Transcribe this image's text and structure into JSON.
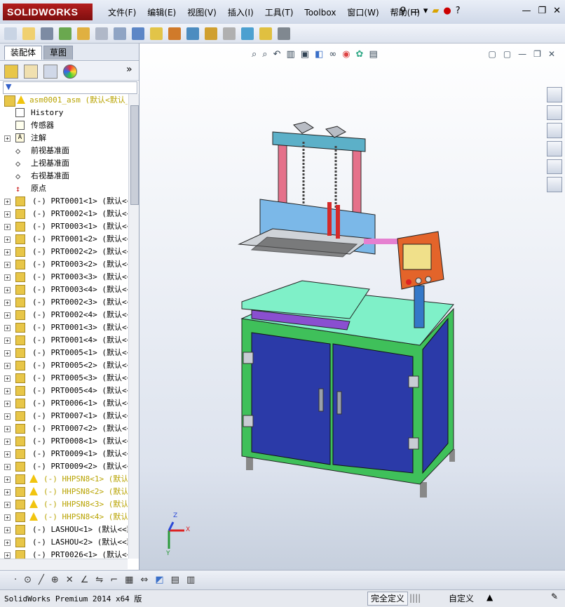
{
  "app": {
    "logo": "SOLIDWORKS"
  },
  "menu": [
    "文件(F)",
    "编辑(E)",
    "视图(V)",
    "插入(I)",
    "工具(T)",
    "Toolbox",
    "窗口(W)",
    "帮助(H)"
  ],
  "panel": {
    "tabs": [
      {
        "label": "装配体",
        "active": true
      },
      {
        "label": "草图",
        "active": false
      }
    ],
    "root": "asm0001_asm  (默认<默认_",
    "fixed_items": [
      "History",
      "传感器",
      "注解",
      "前视基准面",
      "上视基准面",
      "右视基准面",
      "原点"
    ],
    "components": [
      "(-) PRT0001<1> (默认<<",
      "(-) PRT0002<1> (默认<<",
      "(-) PRT0003<1> (默认<<",
      "(-) PRT0001<2> (默认<<",
      "(-) PRT0002<2> (默认<<",
      "(-) PRT0003<2> (默认<<",
      "(-) PRT0003<3> (默认<<",
      "(-) PRT0003<4> (默认<<",
      "(-) PRT0002<3> (默认<<",
      "(-) PRT0002<4> (默认<<",
      "(-) PRT0001<3> (默认<<",
      "(-) PRT0001<4> (默认<<",
      "(-) PRT0005<1> (默认<<",
      "(-) PRT0005<2> (默认<<",
      "(-) PRT0005<3> (默认<<",
      "(-) PRT0005<4> (默认<<",
      "(-) PRT0006<1> (默认<<",
      "(-) PRT0007<1> (默认<<",
      "(-) PRT0007<2> (默认<<",
      "(-) PRT0008<1> (默认<<",
      "(-) PRT0009<1> (默认<<",
      "(-) PRT0009<2> (默认<<"
    ],
    "warn_components": [
      "(-) HHPSN8<1> (默认<",
      "(-) HHPSN8<2> (默认<",
      "(-) HHPSN8<3> (默认<",
      "(-) HHPSN8<4> (默认<"
    ],
    "tail_components": [
      "(-) LASHOU<1> (默认<<默",
      "(-) LASHOU<2> (默认<<默",
      "(-) PRT0026<1> (默认<<"
    ]
  },
  "triad": {
    "x": "X",
    "y": "Y",
    "z": "Z"
  },
  "status": {
    "product": "SolidWorks Premium 2014 x64 版",
    "state": "完全定义",
    "edit": "自定义"
  },
  "colors": {
    "logo": "#b31d1d",
    "cabinet": "#2b3aa8",
    "frame": "#3fc05a",
    "table": "#7ff0c8"
  }
}
